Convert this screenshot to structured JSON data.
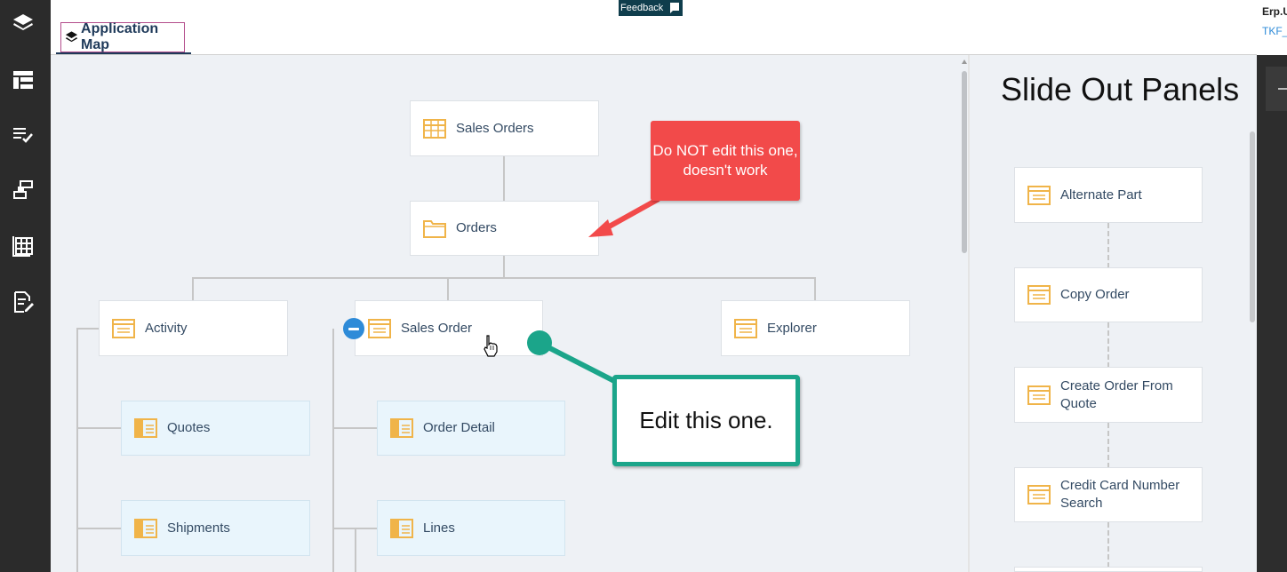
{
  "header": {
    "feedback_label": "Feedback",
    "tab_label": "Application Map",
    "user_name": "Erp.U",
    "user_link": "TKF_"
  },
  "left_rail": {
    "items": [
      "layers-icon",
      "layout-icon",
      "checklist-icon",
      "flow-icon",
      "grid-icon",
      "edit-doc-icon"
    ]
  },
  "map": {
    "root": "Sales Orders",
    "orders": "Orders",
    "children": [
      "Activity",
      "Sales Order",
      "Explorer"
    ],
    "activity_children": [
      "Quotes",
      "Shipments"
    ],
    "sales_order_children": [
      "Order Detail",
      "Lines"
    ]
  },
  "slide_panel": {
    "title": "Slide Out Panels",
    "items": [
      "Alternate Part",
      "Copy Order",
      "Create Order From Quote",
      "Credit Card Number Search"
    ]
  },
  "annotations": {
    "red_note": "Do NOT edit this one, doesn't work",
    "green_note": "Edit this one."
  },
  "colors": {
    "rail_bg": "#2b2b2b",
    "canvas_bg": "#eef1f5",
    "icon_orange": "#f0b449",
    "red_note": "#f24a4a",
    "green_note": "#1ba58a",
    "accent_blue": "#2e8bd8"
  }
}
